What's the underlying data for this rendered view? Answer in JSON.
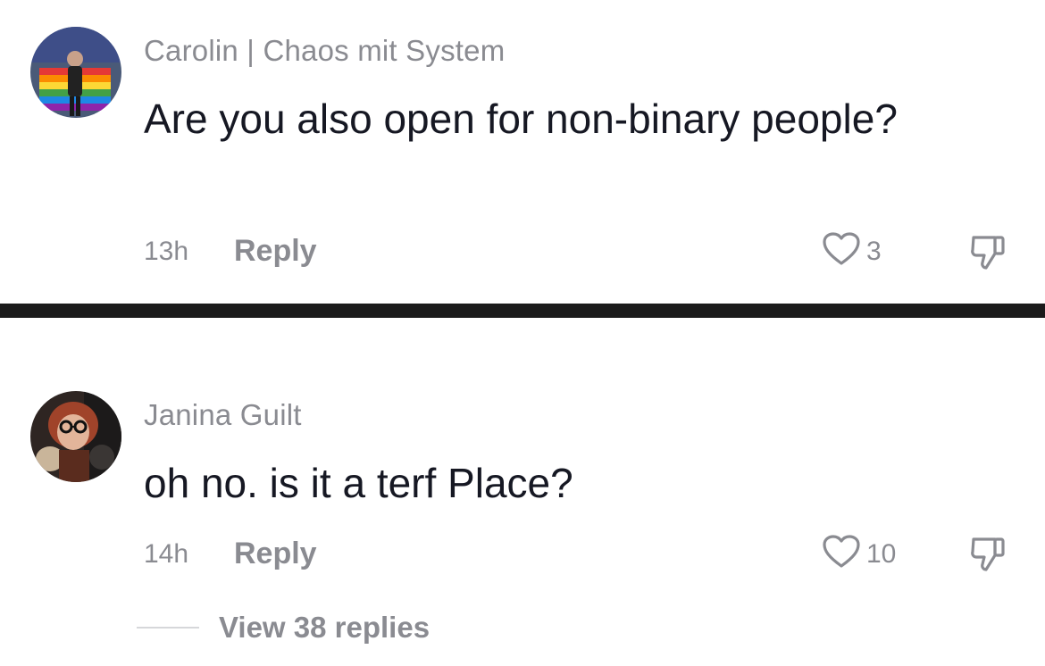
{
  "comments": [
    {
      "username": "Carolin | Chaos mit System",
      "text": "Are you also open for non-binary people?",
      "time": "13h",
      "reply_label": "Reply",
      "like_count": "3",
      "avatar_icon": "user-avatar-pride-flag"
    },
    {
      "username": "Janina Guilt",
      "text": "oh no. is it a terf Place?",
      "time": "14h",
      "reply_label": "Reply",
      "like_count": "10",
      "avatar_icon": "user-avatar-glasses",
      "view_replies_label": "View 38 replies"
    }
  ],
  "icons": {
    "like": "heart-outline-icon",
    "dislike": "thumbs-down-icon"
  },
  "colors": {
    "primary_text": "#161823",
    "secondary_text": "#8a8b91",
    "divider": "#1b1b1b"
  }
}
